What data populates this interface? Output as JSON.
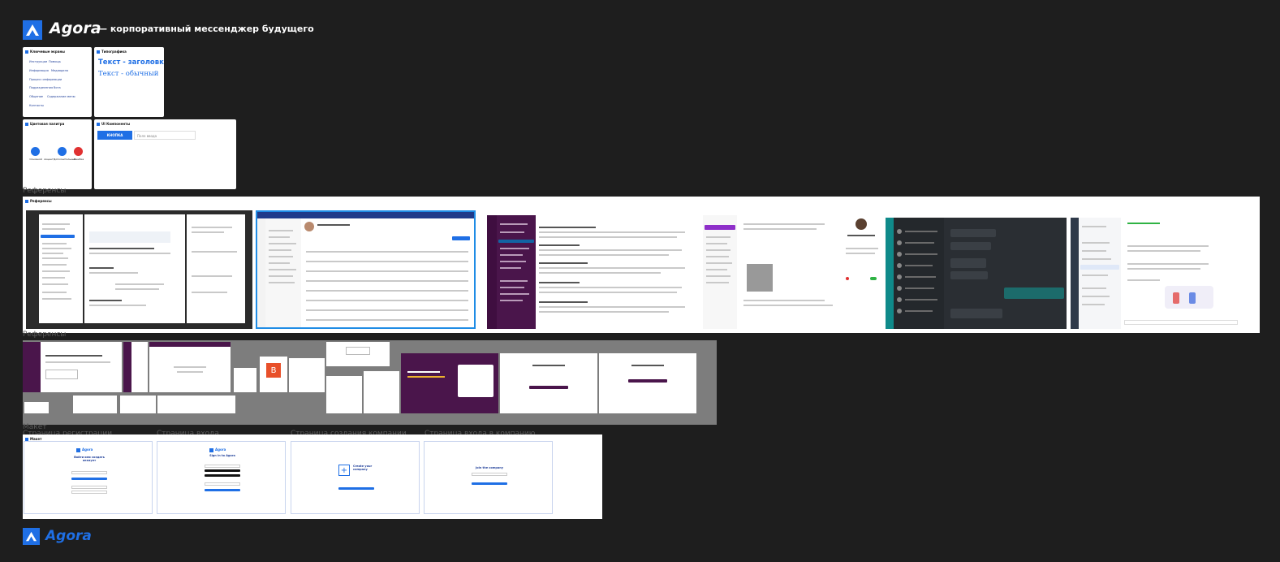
{
  "header": {
    "brand": "Agora",
    "tagline": "— корпоративный мессенджер будущего"
  },
  "key_screens": {
    "title": "Ключевые экраны",
    "items": [
      "Инструкции",
      "Помощь",
      "Информация",
      "Медиадела",
      "Процесс информации",
      "Подразделения бота",
      "Общение",
      "Содержание меню",
      "Контакты"
    ]
  },
  "typography": {
    "title": "Типографика",
    "heading_sample": "Текст - заголовки",
    "body_sample": "Текст - обычный"
  },
  "palette": {
    "title": "Цветовая палитра",
    "colors": [
      {
        "label": "Основной",
        "hex": "#1f6fe5"
      },
      {
        "label": "Акцент",
        "hex": "#1f6fe5"
      },
      {
        "label": "Дополнительный",
        "hex": "#1f6fe5"
      },
      {
        "label": "Ошибка",
        "hex": "#e03131"
      }
    ]
  },
  "ui_components": {
    "title": "UI Компоненты",
    "button_label": "КНОПКА",
    "input_placeholder": "Поле ввода"
  },
  "references_frame": {
    "label": "Референсы",
    "title": "Референсы"
  },
  "references_frame_2": {
    "label": "Референсы"
  },
  "mockup_frame": {
    "label": "Макет",
    "title": "Макет",
    "screens": [
      {
        "caption": "Страница регистрации",
        "heading": "Войти или создать аккаунт"
      },
      {
        "caption": "Страница входа",
        "heading": "Sign in to Agora"
      },
      {
        "caption": "Страница создания компании",
        "heading": "Create your company"
      },
      {
        "caption": "Страница входа в компанию",
        "heading": "Join the company"
      }
    ]
  },
  "footer": {
    "brand": "Agora"
  },
  "colors": {
    "background": "#1e1e1e",
    "accent": "#1f6fe5",
    "error": "#e03131"
  }
}
